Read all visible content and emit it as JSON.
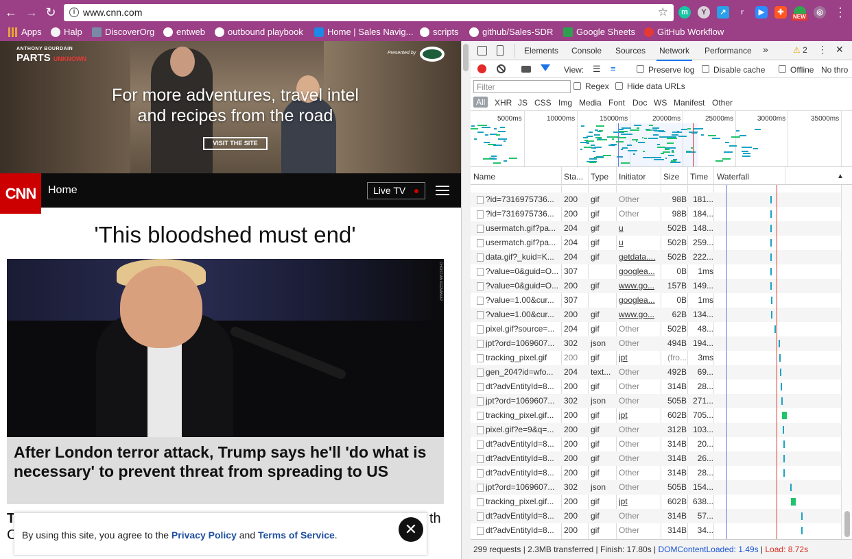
{
  "browser": {
    "url": "www.cnn.com",
    "new_badge": "NEW"
  },
  "bookmarks": [
    {
      "label": "Apps",
      "icon": "apps-grid-icon"
    },
    {
      "label": "Halp",
      "icon": "halp-icon"
    },
    {
      "label": "DiscoverOrg",
      "icon": "discoverorg-icon"
    },
    {
      "label": "entweb",
      "icon": "github-icon"
    },
    {
      "label": "outbound playbook",
      "icon": "github-icon"
    },
    {
      "label": "Home | Sales Navig...",
      "icon": "sales-navigator-icon"
    },
    {
      "label": "scripts",
      "icon": "github-icon"
    },
    {
      "label": "github/Sales-SDR",
      "icon": "github-icon"
    },
    {
      "label": "Google Sheets",
      "icon": "sheets-icon"
    },
    {
      "label": "GitHub Workflow",
      "icon": "workflow-icon"
    }
  ],
  "ad": {
    "brand_small": "ANTHONY BOURDAIN",
    "brand_parts": "PARTS",
    "brand_unknown": "UNKNOWN",
    "presented_by": "Presented by",
    "headline_line1": "For more adventures, travel intel",
    "headline_line2": "and recipes from the road",
    "cta": "VISIT THE SITE"
  },
  "cnn": {
    "logo": "CNN",
    "home": "Home",
    "live_tv": "Live TV",
    "lead_title": "'This bloodshed must end'",
    "lead_caption": "After London terror attack, Trump says he'll 'do what is necessary' to prevent threat from spreading to US",
    "photo_credit": "CHRISTIAN KEENAN/AP",
    "below_fold_start": "T",
    "below_fold_end": "th",
    "below_fold_second": "C"
  },
  "cookie": {
    "prefix": "By using this site, you agree to the ",
    "privacy": "Privacy Policy",
    "and": " and ",
    "terms": "Terms of Service",
    "suffix": ".",
    "close": "✕"
  },
  "devtools": {
    "tabs": [
      "Elements",
      "Console",
      "Sources",
      "Network",
      "Performance"
    ],
    "active_tab": "Network",
    "more": "»",
    "warnings": "2",
    "view_label": "View:",
    "preserve_log": "Preserve log",
    "disable_cache": "Disable cache",
    "offline": "Offline",
    "throttle": "No thro",
    "filter_placeholder": "Filter",
    "regex": "Regex",
    "hide_data_urls": "Hide data URLs",
    "types": [
      "All",
      "XHR",
      "JS",
      "CSS",
      "Img",
      "Media",
      "Font",
      "Doc",
      "WS",
      "Manifest",
      "Other"
    ],
    "timeline_ticks": [
      "5000ms",
      "10000ms",
      "15000ms",
      "20000ms",
      "25000ms",
      "30000ms",
      "35000ms"
    ],
    "columns": [
      "Name",
      "Sta...",
      "Type",
      "Initiator",
      "Size",
      "Time",
      "Waterfall"
    ],
    "rows": [
      {
        "name": "?id=7316975736...",
        "status": "200",
        "type": "gif",
        "initiator": "Other",
        "size": "98B",
        "time": "181...",
        "wf": 0.432
      },
      {
        "name": "?id=7316975736...",
        "status": "200",
        "type": "gif",
        "initiator": "Other",
        "size": "98B",
        "time": "184...",
        "wf": 0.432
      },
      {
        "name": "usermatch.gif?pa...",
        "status": "204",
        "type": "gif",
        "initiator": "u",
        "size": "502B",
        "time": "148...",
        "wf": 0.434
      },
      {
        "name": "usermatch.gif?pa...",
        "status": "204",
        "type": "gif",
        "initiator": "u",
        "size": "502B",
        "time": "259...",
        "wf": 0.436
      },
      {
        "name": "data.gif?_kuid=K...",
        "status": "204",
        "type": "gif",
        "initiator": "getdata....",
        "size": "502B",
        "time": "222...",
        "wf": 0.436
      },
      {
        "name": "?value=0&guid=O...",
        "status": "307",
        "type": "",
        "initiator": "googlea...",
        "size": "0B",
        "time": "1ms",
        "wf": 0.436
      },
      {
        "name": "?value=0&guid=O...",
        "status": "200",
        "type": "gif",
        "initiator": "www.go...",
        "size": "157B",
        "time": "149...",
        "wf": 0.436
      },
      {
        "name": "?value=1.00&cur...",
        "status": "307",
        "type": "",
        "initiator": "googlea...",
        "size": "0B",
        "time": "1ms",
        "wf": 0.437
      },
      {
        "name": "?value=1.00&cur...",
        "status": "200",
        "type": "gif",
        "initiator": "www.go...",
        "size": "62B",
        "time": "134...",
        "wf": 0.437
      },
      {
        "name": "pixel.gif?source=...",
        "status": "204",
        "type": "gif",
        "initiator": "Other",
        "size": "502B",
        "time": "48...",
        "wf": 0.465
      },
      {
        "name": "jpt?ord=1069607...",
        "status": "302",
        "type": "json",
        "initiator": "Other",
        "size": "494B",
        "time": "194...",
        "wf": 0.5
      },
      {
        "name": "tracking_pixel.gif",
        "status": "200",
        "type": "gif",
        "initiator": "jpt",
        "size": "(fro...",
        "time": "3ms",
        "wf": 0.503
      },
      {
        "name": "gen_204?id=wfo...",
        "status": "204",
        "type": "text...",
        "initiator": "Other",
        "size": "492B",
        "time": "69...",
        "wf": 0.512
      },
      {
        "name": "dt?advEntityId=8...",
        "status": "200",
        "type": "gif",
        "initiator": "Other",
        "size": "314B",
        "time": "28...",
        "wf": 0.515
      },
      {
        "name": "jpt?ord=1069607...",
        "status": "302",
        "type": "json",
        "initiator": "Other",
        "size": "505B",
        "time": "271...",
        "wf": 0.52
      },
      {
        "name": "tracking_pixel.gif...",
        "status": "200",
        "type": "gif",
        "initiator": "jpt",
        "size": "602B",
        "time": "705...",
        "wf": 0.525
      },
      {
        "name": "pixel.gif?e=9&q=...",
        "status": "200",
        "type": "gif",
        "initiator": "Other",
        "size": "312B",
        "time": "103...",
        "wf": 0.535
      },
      {
        "name": "dt?advEntityId=8...",
        "status": "200",
        "type": "gif",
        "initiator": "Other",
        "size": "314B",
        "time": "20...",
        "wf": 0.538
      },
      {
        "name": "dt?advEntityId=8...",
        "status": "200",
        "type": "gif",
        "initiator": "Other",
        "size": "314B",
        "time": "26...",
        "wf": 0.54
      },
      {
        "name": "dt?advEntityId=8...",
        "status": "200",
        "type": "gif",
        "initiator": "Other",
        "size": "314B",
        "time": "28...",
        "wf": 0.54
      },
      {
        "name": "jpt?ord=1069607...",
        "status": "302",
        "type": "json",
        "initiator": "Other",
        "size": "505B",
        "time": "154...",
        "wf": 0.595
      },
      {
        "name": "tracking_pixel.gif...",
        "status": "200",
        "type": "gif",
        "initiator": "jpt",
        "size": "602B",
        "time": "638...",
        "wf": 0.6
      },
      {
        "name": "dt?advEntityId=8...",
        "status": "200",
        "type": "gif",
        "initiator": "Other",
        "size": "314B",
        "time": "57...",
        "wf": 0.68
      },
      {
        "name": "dt?advEntityId=8...",
        "status": "200",
        "type": "gif",
        "initiator": "Other",
        "size": "314B",
        "time": "34...",
        "wf": 0.68
      }
    ],
    "status_bar": {
      "summary": "299 requests | 2.3MB transferred | Finish: 17.80s | ",
      "dcl": "DOMContentLoaded: 1.49s",
      "sep": " | ",
      "load": "Load: 8.72s"
    }
  },
  "colors": {
    "chrome_purple": "#9b3f86",
    "cnn_red": "#cc0000",
    "devtools_blue": "#1a73e8",
    "waterfall_teal": "#1aa2c4",
    "waterfall_green": "#21c46a"
  }
}
